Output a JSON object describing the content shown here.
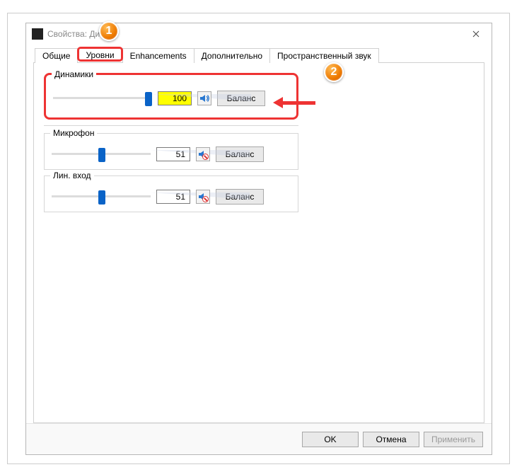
{
  "window": {
    "title": "Свойства: Ди"
  },
  "tabs": {
    "general": "Общие",
    "levels": "Уровни",
    "enhancements": "Enhancements",
    "advanced": "Дополнительно",
    "spatial": "Пространственный звук"
  },
  "speakers": {
    "label": "Динамики",
    "value": "100",
    "slider_pct": 100,
    "balance_btn": "Баланс",
    "muted": false
  },
  "microphone": {
    "label": "Микрофон",
    "value": "51",
    "slider_pct": 51,
    "balance_btn": "Баланс",
    "muted": true
  },
  "linein": {
    "label": "Лин. вход",
    "value": "51",
    "slider_pct": 51,
    "balance_btn": "Баланс",
    "muted": true
  },
  "footer": {
    "ok": "OK",
    "cancel": "Отмена",
    "apply": "Применить"
  },
  "callouts": {
    "one": "1",
    "two": "2"
  },
  "icons": {
    "close": "close-icon",
    "app": "speaker-app-icon",
    "sound": "sound-icon"
  }
}
